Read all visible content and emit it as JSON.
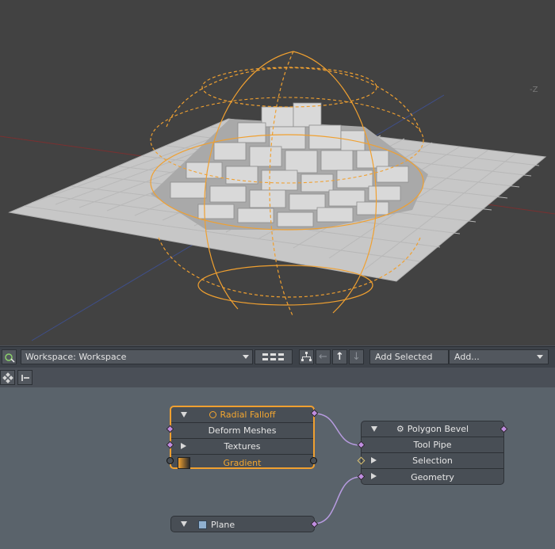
{
  "viewport": {
    "axis_label": "-Z"
  },
  "toolbar": {
    "workspace_select": "Workspace: Workspace",
    "add_selected": "Add Selected",
    "add_menu": "Add..."
  },
  "nodes": {
    "radial_falloff": {
      "title": "Radial Falloff",
      "rows": [
        "Deform Meshes",
        "Textures",
        "Gradient"
      ]
    },
    "polygon_bevel": {
      "title": "Polygon Bevel",
      "rows": [
        "Tool Pipe",
        "Selection",
        "Geometry"
      ]
    },
    "plane": {
      "title": "Plane"
    }
  },
  "colors": {
    "selection": "#f0a030",
    "port": "#c08de0",
    "wire": "#b79be0"
  }
}
